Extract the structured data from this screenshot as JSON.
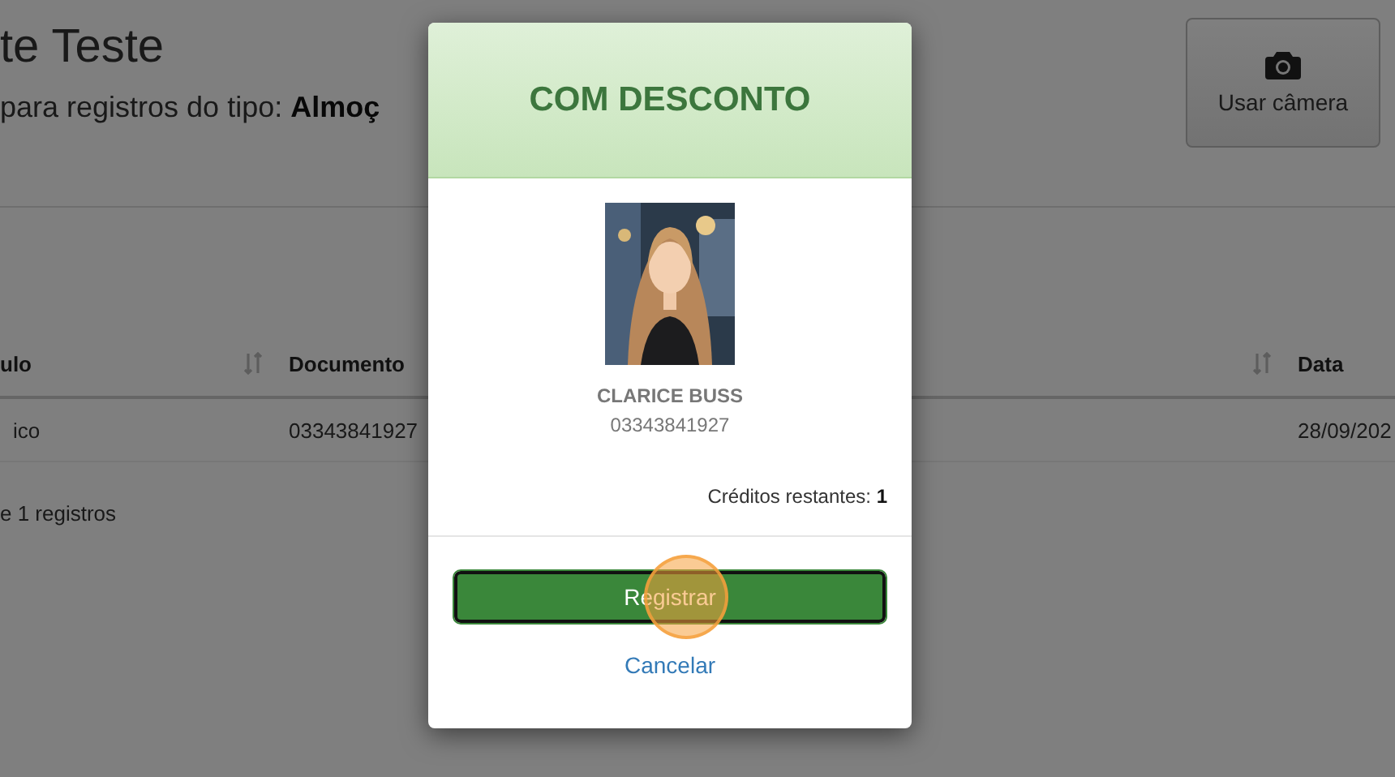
{
  "page": {
    "title": "te Teste",
    "subtitle": "para registros do tipo: **Almoç**",
    "camera_button": {
      "label": "Usar câmera"
    },
    "table": {
      "columns": [
        {
          "label": "ulo",
          "sortable": true
        },
        {
          "label": "Documento",
          "sortable": true
        },
        {
          "label": "Data",
          "sortable": false
        }
      ],
      "rows": [
        [
          "ico",
          "03343841927",
          "28/09/202"
        ]
      ]
    },
    "footer": "e 1 registros"
  },
  "modal": {
    "header": "COM DESCONTO",
    "person": {
      "name": "CLARICE BUSS",
      "document": "03343841927"
    },
    "credits_label": "Créditos restantes:",
    "credits_value": "1",
    "primary_button": "Registrar",
    "click_marker": true,
    "cancel_link": "Cancelar"
  }
}
